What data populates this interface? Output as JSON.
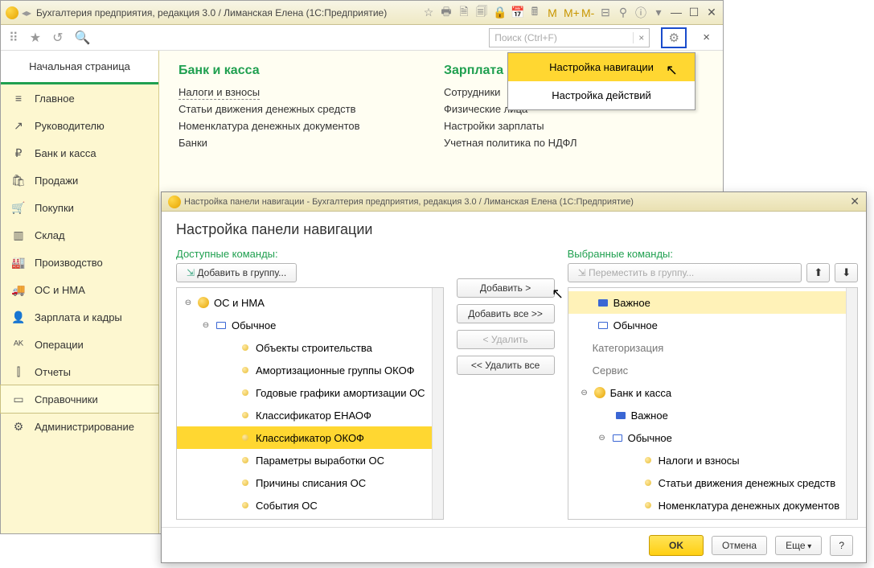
{
  "main": {
    "title": "Бухгалтерия предприятия, редакция 3.0 / Лиманская Елена  (1С:Предприятие)",
    "home_tab": "Начальная страница",
    "search_placeholder": "Поиск (Ctrl+F)",
    "nav": [
      {
        "icon": "≡",
        "label": "Главное"
      },
      {
        "icon": "↗",
        "label": "Руководителю"
      },
      {
        "icon": "₽",
        "label": "Банк и касса"
      },
      {
        "icon": "🛍",
        "label": "Продажи"
      },
      {
        "icon": "🛒",
        "label": "Покупки"
      },
      {
        "icon": "▥",
        "label": "Склад"
      },
      {
        "icon": "🏭",
        "label": "Производство"
      },
      {
        "icon": "🚚",
        "label": "ОС и НМА"
      },
      {
        "icon": "👤",
        "label": "Зарплата и кадры"
      },
      {
        "icon": "ᴬᴷ",
        "label": "Операции"
      },
      {
        "icon": "⫿",
        "label": "Отчеты"
      },
      {
        "icon": "▭",
        "label": "Справочники"
      },
      {
        "icon": "⚙",
        "label": "Администрирование"
      }
    ],
    "col1": {
      "title": "Банк и касса",
      "links": [
        "Налоги и взносы",
        "Статьи движения денежных средств",
        "Номенклатура денежных документов",
        "Банки"
      ]
    },
    "col2": {
      "title": "Зарплата и кадры",
      "links": [
        "Сотрудники",
        "Физические лица",
        "Настройки зарплаты",
        "Учетная политика по НДФЛ"
      ]
    }
  },
  "dropdown": {
    "item1": "Настройка навигации",
    "item2": "Настройка действий"
  },
  "dialog": {
    "title": "Настройка панели навигации - Бухгалтерия предприятия, редакция 3.0 / Лиманская Елена  (1С:Предприятие)",
    "h1": "Настройка панели навигации",
    "available_label": "Доступные команды:",
    "selected_label": "Выбранные команды:",
    "add_to_group": "Добавить в группу...",
    "move_to_group": "Переместить в группу...",
    "btn_add": "Добавить >",
    "btn_add_all": "Добавить все >>",
    "btn_remove": "< Удалить",
    "btn_remove_all": "<< Удалить все",
    "ok": "OK",
    "cancel": "Отмена",
    "more": "Еще",
    "left_tree": {
      "root": "ОС и НМА",
      "group": "Обычное",
      "items": [
        "Объекты строительства",
        "Амортизационные группы ОКОФ",
        "Годовые графики амортизации ОС",
        "Классификатор ЕНАОФ",
        "Классификатор ОКОФ",
        "Параметры выработки ОС",
        "Причины списания ОС",
        "События ОС"
      ]
    },
    "right_tree": {
      "important": "Важное",
      "usual": "Обычное",
      "categorization": "Категоризация",
      "service": "Сервис",
      "bank": "Банк и касса",
      "bank_important": "Важное",
      "bank_usual": "Обычное",
      "bank_items": [
        "Налоги и взносы",
        "Статьи движения денежных средств",
        "Номенклатура денежных документов"
      ]
    }
  }
}
